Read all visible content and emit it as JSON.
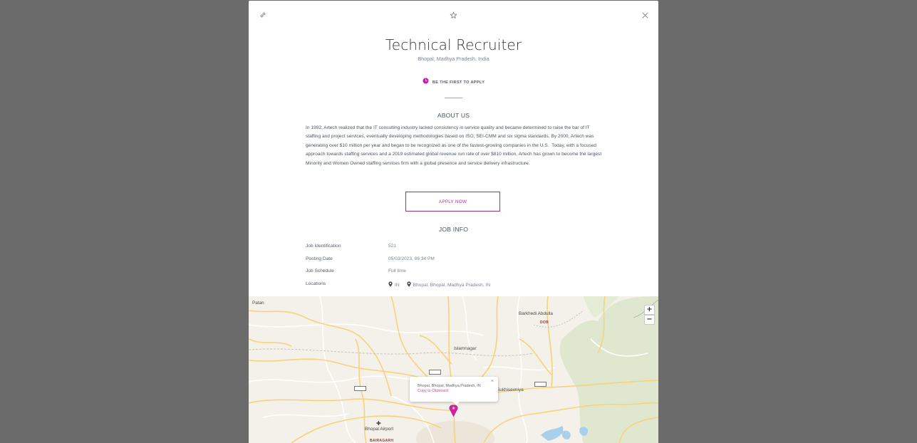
{
  "job": {
    "title": "Technical Recruiter",
    "location": "Bhopal, Madhya Pradesh, India",
    "first_apply_label": "BE THE FIRST TO APPLY"
  },
  "about": {
    "heading": "ABOUT US",
    "text": "In 1992, Artech realized that the IT consulting industry lacked consistency in service quality and became determined to raise the bar of IT staffing and project services, eventually developing methodologies based on ISO, SEI-CMM and six sigma standards. By 2000, Artech was generating over $10 million per year and began to be recognized as one of the fastest-growing companies in the U.S.  Today, with a focused approach towards staffing services and a 2019 estimated global revenue run rate of over $810 million, Artech has grown to become the largest Minority and Women Owned staffing services firm with a global presence and service delivery infrastructure."
  },
  "apply_button": "APPLY NOW",
  "job_info": {
    "heading": "JOB INFO",
    "rows": [
      {
        "label": "Job Identification",
        "value": "521"
      },
      {
        "label": "Posting Date",
        "value": "05/03/2023, 06:34 PM"
      },
      {
        "label": "Job Schedule",
        "value": "Full time"
      },
      {
        "label": "Locations",
        "value": "IN",
        "value2": "Bhopal, Bhopal, Madhya Pradesh, IN"
      }
    ]
  },
  "map": {
    "places": {
      "patan": "Patan",
      "barkhedi": "Barkhedi Abdulla",
      "dob": "DOB",
      "islamnagar": "Islamnagar",
      "sukhisewniya": "Sukhisevniya",
      "bhopal_airport": "Bhopal Airport",
      "bairagarh": "BAIRAGARH"
    },
    "zoom_in": "+",
    "zoom_out": "−",
    "popup_address": "Bhopal, Bhopal, Madhya Pradesh, IN",
    "popup_copy": "Copy to Clipboard",
    "popup_close": "×"
  },
  "colors": {
    "accent": "#b0359f",
    "marker": "#d6249f",
    "backdrop": "#6b6b6b"
  },
  "icons": {
    "top_left": "link-icon",
    "top_center": "star-icon",
    "top_right": "close-icon",
    "first_apply": "clock-icon",
    "location": "map-pin-icon"
  }
}
